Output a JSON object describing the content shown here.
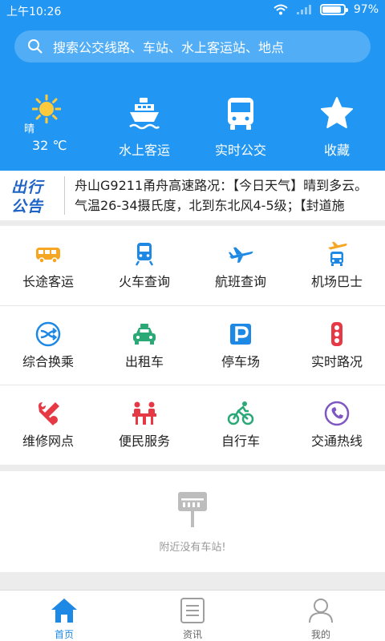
{
  "status_bar": {
    "time": "上午10:26",
    "battery": "97%",
    "battery_level": 0.97
  },
  "search": {
    "placeholder": "搜索公交线路、车站、水上客运站、地点"
  },
  "weather": {
    "condition": "晴",
    "temperature": "32 ℃"
  },
  "quick_actions": [
    {
      "label": "水上客运",
      "icon": "ship-icon"
    },
    {
      "label": "实时公交",
      "icon": "bus-icon"
    },
    {
      "label": "收藏",
      "icon": "star-icon"
    }
  ],
  "notice": {
    "badge_line1": "出行",
    "badge_line2": "公告",
    "text": "舟山G9211甬舟高速路况：【今日天气】晴到多云。气温26-34摄氏度，北到东北风4-5级；【封道施"
  },
  "services": [
    {
      "label": "长途客运",
      "icon": "coach-icon",
      "color": "#f5a623"
    },
    {
      "label": "火车查询",
      "icon": "train-icon",
      "color": "#1e88e5"
    },
    {
      "label": "航班查询",
      "icon": "airplane-icon",
      "color": "#1e88e5"
    },
    {
      "label": "机场巴士",
      "icon": "airport-bus-icon",
      "color": "#f5a623"
    },
    {
      "label": "综合换乘",
      "icon": "transfer-icon",
      "color": "#1e88e5"
    },
    {
      "label": "出租车",
      "icon": "taxi-icon",
      "color": "#2aa876"
    },
    {
      "label": "停车场",
      "icon": "parking-icon",
      "color": "#1e88e5"
    },
    {
      "label": "实时路况",
      "icon": "traffic-light-icon",
      "color": "#e53945"
    },
    {
      "label": "维修网点",
      "icon": "repair-icon",
      "color": "#e53945"
    },
    {
      "label": "便民服务",
      "icon": "service-desk-icon",
      "color": "#e53945"
    },
    {
      "label": "自行车",
      "icon": "bicycle-icon",
      "color": "#2aa876"
    },
    {
      "label": "交通热线",
      "icon": "phone-icon",
      "color": "#7e57c2"
    }
  ],
  "nearby": {
    "message": "附近没有车站!"
  },
  "tabbar": [
    {
      "label": "首页",
      "icon": "home-icon",
      "active": true
    },
    {
      "label": "资讯",
      "icon": "news-icon",
      "active": false
    },
    {
      "label": "我的",
      "icon": "profile-icon",
      "active": false
    }
  ],
  "colors": {
    "primary": "#2196f3",
    "tab_active": "#1e88e5"
  }
}
